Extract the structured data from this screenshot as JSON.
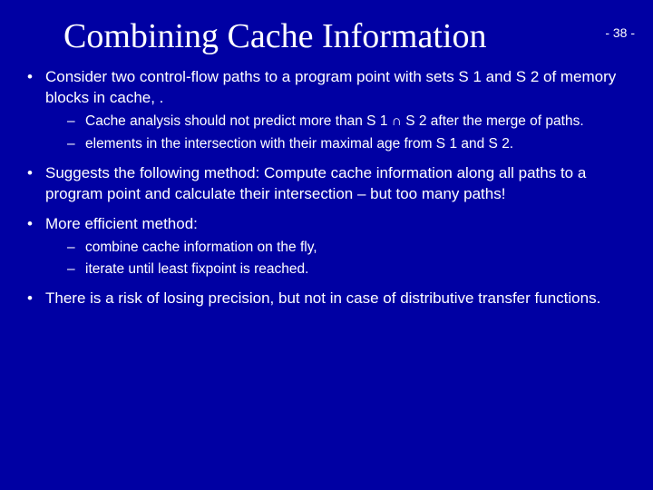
{
  "page_number": "- 38 -",
  "title": "Combining Cache Information",
  "bullets": [
    {
      "text": "Consider two control-flow paths to a program point with sets S 1 and S 2 of memory blocks in cache, .",
      "sub": [
        "Cache analysis should not predict more than S 1 ∩ S 2 after the merge of paths.",
        "elements in the intersection with their maximal age from S 1 and S 2."
      ]
    },
    {
      "text": "Suggests the following method: Compute cache information along all paths to a program point and calculate their intersection – but too many paths!",
      "sub": []
    },
    {
      "text": "More efficient method:",
      "sub": [
        "combine cache information on the fly,",
        "iterate until least fixpoint is reached."
      ]
    },
    {
      "text": "There is a risk of losing precision, but not in case of distributive transfer functions.",
      "sub": []
    }
  ]
}
